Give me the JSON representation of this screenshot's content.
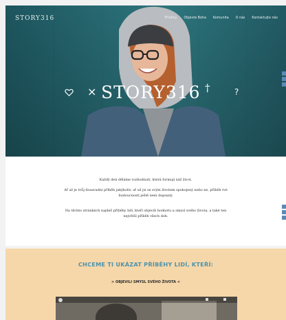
{
  "header": {
    "brand": "STORY316",
    "nav": [
      "Příběhy",
      "Objevte Boha",
      "Komunita",
      "O nás",
      "Kontaktujte nás"
    ]
  },
  "hero": {
    "title": "STORY316",
    "icons": [
      "heart-icon",
      "cross-icon",
      "dagger-icon",
      "question-icon"
    ]
  },
  "intro": {
    "p1": "Každý den děláme rozhodnutí, která formují náš život.",
    "p2a": "Ať už je tvůj dosavadní příběh jakýkoliv, ať už jsi se svým životem spokojený nebo ne, příběh tvé",
    "p2b": "budoucnosti ještě není dopsaný.",
    "p3a": "Na těchto stránkách najdeš příběhy lidí, kteří objevili hodnotu a smysl svého života, a také ten",
    "p3b": "největší příběh všech dob."
  },
  "section": {
    "heading": "CHCEME TI UKÁZAT PŘÍBĚHY LIDÍ, KTEŘÍ:",
    "sub": "> OBJEVILI SMYSL SVÉHO ŽIVOTA <"
  },
  "video": {
    "title": ""
  },
  "colors": {
    "hero": "#2a6f78",
    "accent": "#4d93ad",
    "peach": "#f6d7a9"
  }
}
